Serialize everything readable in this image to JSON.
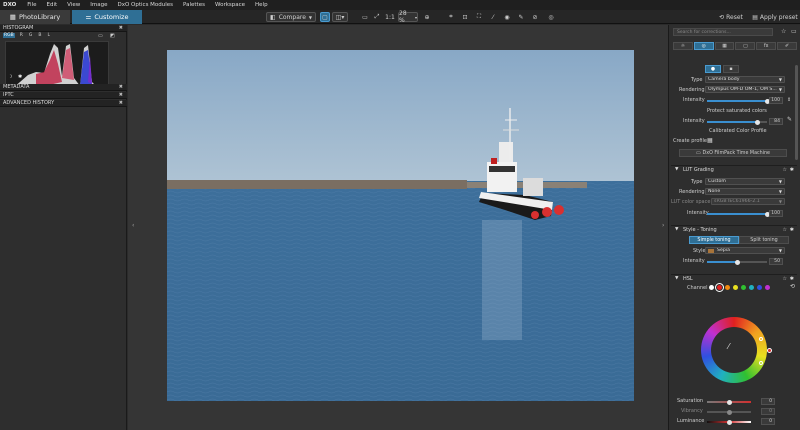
{
  "app": {
    "logo": "DXO"
  },
  "menu": [
    "File",
    "Edit",
    "View",
    "Image",
    "DxO Optics Modules",
    "Palettes",
    "Workspace",
    "Help"
  ],
  "tabs": {
    "photolibrary": "PhotoLibrary",
    "customize": "Customize"
  },
  "toolbar": {
    "compare": "Compare",
    "ratio": "1:1",
    "zoom": "28 %",
    "reset": "Reset",
    "apply_preset": "Apply preset"
  },
  "left": {
    "histogram_title": "HISTOGRAM",
    "histogram_channels": [
      "RGB",
      "R",
      "G",
      "B",
      "L"
    ],
    "metadata": "METADATA",
    "iptc": "IPTC",
    "advanced_history": "ADVANCED HISTORY"
  },
  "right": {
    "search_placeholder": "Search for corrections...",
    "color_rendering": {
      "type_label": "Type",
      "type_value": "Camera body",
      "rendering_label": "Rendering",
      "rendering_value": "Olympus OM-D OM-1, OM S...",
      "intensity_label": "Intensity",
      "intensity_value": "100",
      "intensity_fraction": 1.0,
      "protect_label": "Protect saturated colors",
      "protect_intensity_label": "Intensity",
      "protect_intensity_value": "84",
      "protect_fraction": 0.84,
      "calibrated_label": "Calibrated Color Profile",
      "create_profile_label": "Create profile",
      "filmpack_button": "DxO FilmPack Time Machine"
    },
    "lut": {
      "title": "LUT Grading",
      "type_label": "Type",
      "type_value": "Custom",
      "rendering_label": "Rendering",
      "rendering_value": "None",
      "colorspace_label": "LUT color space",
      "colorspace_value": "sRGB IEC61966-2.1",
      "intensity_label": "Intensity",
      "intensity_value": "100",
      "intensity_fraction": 1.0
    },
    "style_toning": {
      "title": "Style - Toning",
      "simple_label": "Simple toning",
      "split_label": "Split toning",
      "style_label": "Style",
      "style_value": "Sepia",
      "intensity_label": "Intensity",
      "intensity_value": "50",
      "intensity_fraction": 0.5
    },
    "hsl": {
      "title": "HSL",
      "channel_label": "Channel",
      "channel_colors": [
        "#ffffff",
        "#e02020",
        "#f08a10",
        "#e8e020",
        "#30c030",
        "#20b0c0",
        "#3050e0",
        "#c030d0"
      ],
      "saturation_label": "Saturation",
      "saturation_value": "0",
      "vibrancy_label": "Vibrancy",
      "vibrancy_value": "0",
      "luminance_label": "Luminance",
      "luminance_value": "0"
    }
  },
  "colors": {
    "accent": "#2f6f95",
    "slider": "#3a8fd0"
  }
}
